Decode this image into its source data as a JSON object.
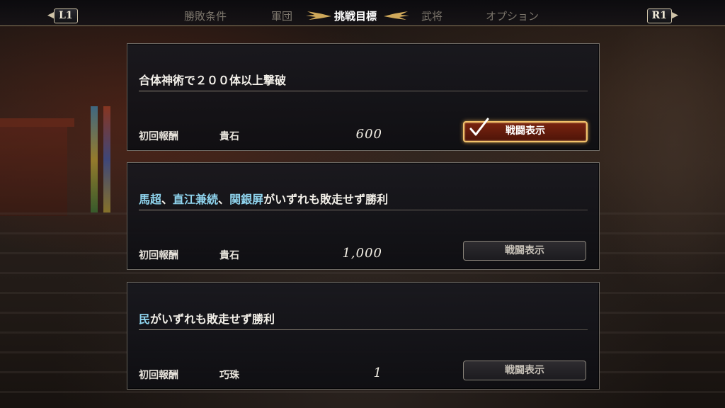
{
  "nav": {
    "left_button": "L1",
    "right_button": "R1",
    "tabs": [
      {
        "label": "勝敗条件",
        "active": false
      },
      {
        "label": "軍団",
        "active": false
      },
      {
        "label": "挑戦目標",
        "active": true
      },
      {
        "label": "武将",
        "active": false
      },
      {
        "label": "オプション",
        "active": false
      }
    ]
  },
  "missions": [
    {
      "title_parts": [
        {
          "text": "合体神術で２００体以上撃破",
          "highlight": false
        }
      ],
      "reward_label": "初回報酬",
      "reward_item": "貴石",
      "reward_amount": "600",
      "button_label": "戦闘表示",
      "button_active": true
    },
    {
      "title_parts": [
        {
          "text": "馬超",
          "highlight": true
        },
        {
          "text": "、",
          "highlight": false
        },
        {
          "text": "直江兼続",
          "highlight": true
        },
        {
          "text": "、",
          "highlight": false
        },
        {
          "text": "関銀屏",
          "highlight": true
        },
        {
          "text": "がいずれも敗走せず勝利",
          "highlight": false
        }
      ],
      "reward_label": "初回報酬",
      "reward_item": "貴石",
      "reward_amount": "1,000",
      "button_label": "戦闘表示",
      "button_active": false
    },
    {
      "title_parts": [
        {
          "text": "民",
          "highlight": true
        },
        {
          "text": "がいずれも敗走せず勝利",
          "highlight": false
        }
      ],
      "reward_label": "初回報酬",
      "reward_item": "巧珠",
      "reward_amount": "1",
      "button_label": "戦闘表示",
      "button_active": false
    }
  ],
  "colors": {
    "highlight_name": "#8fd4ee",
    "active_button_border": "#f2c26a",
    "active_button_fill": "#7a2410"
  },
  "icons": [
    "checkmark-icon",
    "wing-ornament-icon",
    "left-arrow-icon",
    "right-arrow-icon"
  ]
}
